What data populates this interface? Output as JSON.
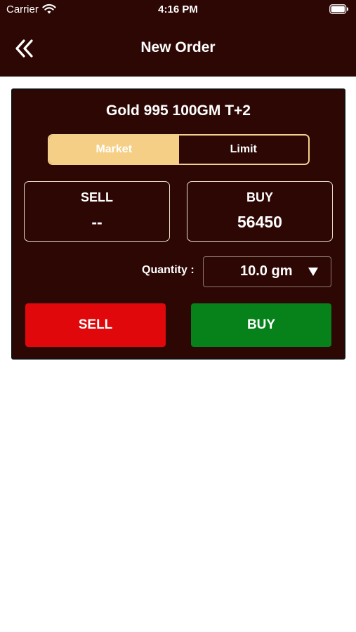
{
  "status_bar": {
    "carrier": "Carrier",
    "time": "4:16 PM"
  },
  "header": {
    "title": "New Order",
    "back_icon": "double-chevron-left-icon"
  },
  "order": {
    "instrument": "Gold 995 100GM T+2",
    "order_types": [
      {
        "label": "Market",
        "selected": true
      },
      {
        "label": "Limit",
        "selected": false
      }
    ],
    "sell": {
      "label": "SELL",
      "price": "--"
    },
    "buy": {
      "label": "BUY",
      "price": "56450"
    },
    "quantity_label": "Quantity :",
    "quantity_value": "10.0 gm",
    "sell_button_label": "SELL",
    "buy_button_label": "BUY"
  },
  "colors": {
    "header_background": "#2d0704",
    "segment_active": "#f5cf85",
    "sell_button": "#e0080a",
    "buy_button": "#07821a"
  }
}
